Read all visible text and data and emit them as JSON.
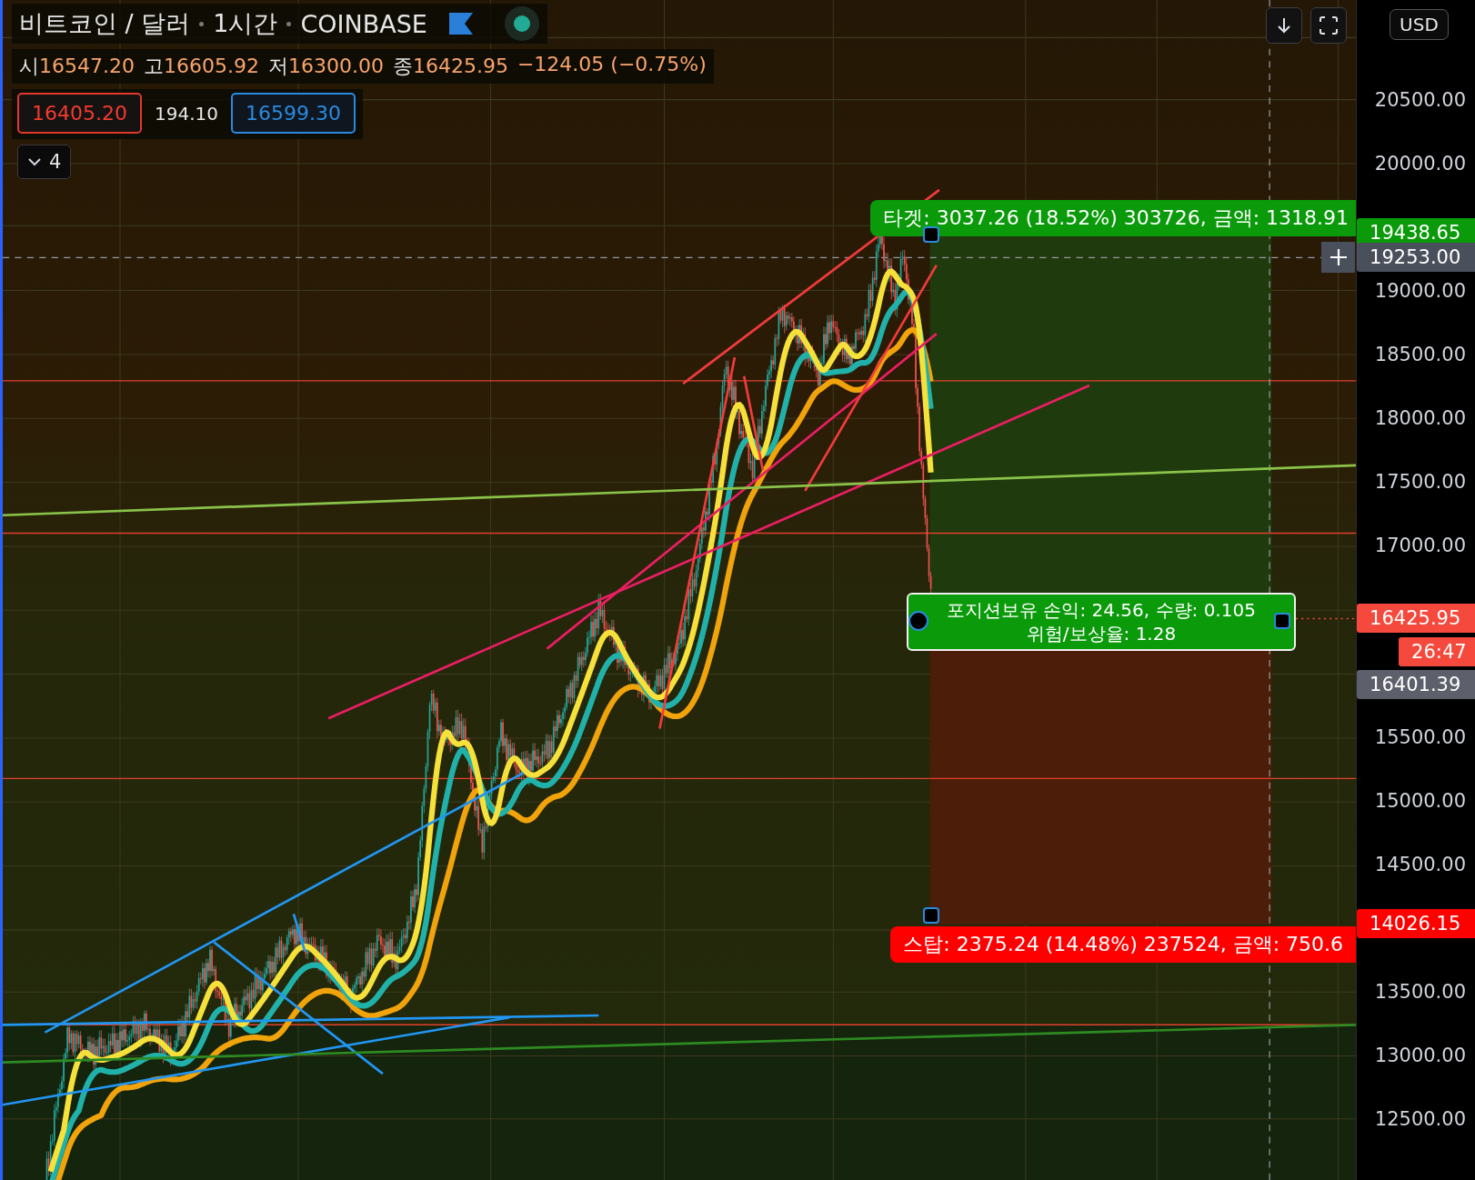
{
  "header": {
    "symbol": "비트코인 / 달러",
    "interval": "1시간",
    "exchange": "COINBASE"
  },
  "ohlc": [
    {
      "label": "시",
      "value": "16547.20"
    },
    {
      "label": "고",
      "value": "16605.92"
    },
    {
      "label": "저",
      "value": "16300.00"
    },
    {
      "label": "종",
      "value": "16425.95"
    }
  ],
  "change": "−124.05 (−0.75%)",
  "quote": {
    "bid": "16405.20",
    "spread": "194.10",
    "ask": "16599.30"
  },
  "indicators_toggle": {
    "count": "4"
  },
  "currency": "USD",
  "price_axis": {
    "ticks": [
      "20500.00",
      "20000.00",
      "19000.00",
      "18500.00",
      "18000.00",
      "17500.00",
      "17000.00",
      "15500.00",
      "15000.00",
      "14500.00",
      "13500.00",
      "13000.00",
      "12500.00"
    ],
    "labels": [
      {
        "kind": "target",
        "text": "19438.65"
      },
      {
        "kind": "crosshair",
        "text": "19253.00"
      },
      {
        "kind": "last",
        "text": "16425.95"
      },
      {
        "kind": "countdown",
        "text": "26:47"
      },
      {
        "kind": "entry",
        "text": "16401.39"
      },
      {
        "kind": "stop",
        "text": "14026.15"
      }
    ]
  },
  "position": {
    "target": "타겟: 3037.26 (18.52%) 303726, 금액: 1318.91",
    "status_lines": [
      "포지션보유 손익: 24.56, 수량: 0.105",
      "위험/보상율: 1.28"
    ],
    "stop": "스탑: 2375.24 (14.48%) 237524, 금액: 750.6"
  }
}
